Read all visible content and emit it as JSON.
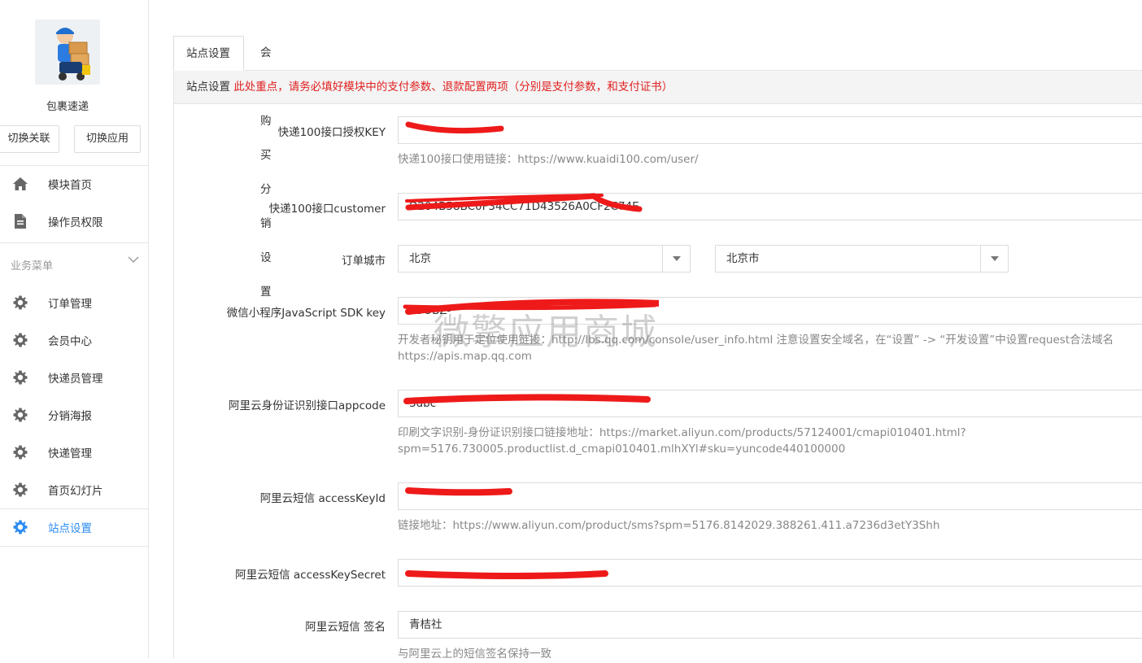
{
  "sidebar": {
    "app_name": "包裹速递",
    "buttons": {
      "switch_link": "切换关联",
      "switch_app": "切换应用"
    },
    "top_items": [
      {
        "label": "模块首页",
        "icon": "home-icon"
      },
      {
        "label": "操作员权限",
        "icon": "document-icon"
      }
    ],
    "section_title": "业务菜单",
    "business_items": [
      {
        "label": "订单管理",
        "icon": "gear-icon"
      },
      {
        "label": "会员中心",
        "icon": "gear-icon"
      },
      {
        "label": "快递员管理",
        "icon": "gear-icon"
      },
      {
        "label": "分销海报",
        "icon": "gear-icon"
      },
      {
        "label": "快递管理",
        "icon": "gear-icon"
      },
      {
        "label": "首页幻灯片",
        "icon": "gear-icon"
      },
      {
        "label": "站点设置",
        "icon": "gear-icon",
        "active": true
      }
    ]
  },
  "tabs": [
    {
      "label": "站点设置",
      "active": true
    },
    {
      "label": "会员购买分销设置",
      "active": false
    }
  ],
  "notice": {
    "lead": "站点设置",
    "text": "此处重点，请务必填好模块中的支付参数、退款配置两项（分别是支付参数，和支付证书）"
  },
  "form": {
    "kuaidi_key": {
      "label": "快递100接口授权KEY",
      "value": "",
      "help": "快递100接口使用链接：https://www.kuaidi100.com/user/"
    },
    "kuaidi_customer": {
      "label": "快递100接口customer",
      "value": "D204B58BC0F34CC71D43526A0CF2C74E"
    },
    "order_city": {
      "label": "订单城市",
      "province": "北京",
      "city": "北京市"
    },
    "js_sdk_key": {
      "label": "微信小程序JavaScript SDK key",
      "value": "K5OBZ-",
      "help_line1": "开发者秘钥用于定位使用链接：http://lbs.qq.com/console/user_info.html 注意设置安全域名，在“设置” -> “开发设置”中设置request合法域名",
      "help_line2": "https://apis.map.qq.com"
    },
    "aliyun_appcode": {
      "label": "阿里云身份证识别接口appcode",
      "value": "3dbc",
      "help_line1": "印刷文字识别-身份证识别接口链接地址：https://market.aliyun.com/products/57124001/cmapi010401.html?",
      "help_line2": "spm=5176.730005.productlist.d_cmapi010401.mlhXYl#sku=yuncode440100000"
    },
    "sms_key_id": {
      "label": "阿里云短信 accessKeyId",
      "value": "",
      "help": "链接地址：https://www.aliyun.com/product/sms?spm=5176.8142029.388261.411.a7236d3etY3Shh"
    },
    "sms_key_secret": {
      "label": "阿里云短信 accessKeySecret",
      "value": ""
    },
    "sms_sign": {
      "label": "阿里云短信 签名",
      "value": "青桔社",
      "help": "与阿里云上的短信签名保持一致"
    }
  },
  "watermark": "微擎应用商城",
  "colors": {
    "accent": "#2d8cf0",
    "notice_red": "#e02020",
    "redaction": "#ee1a1a"
  }
}
